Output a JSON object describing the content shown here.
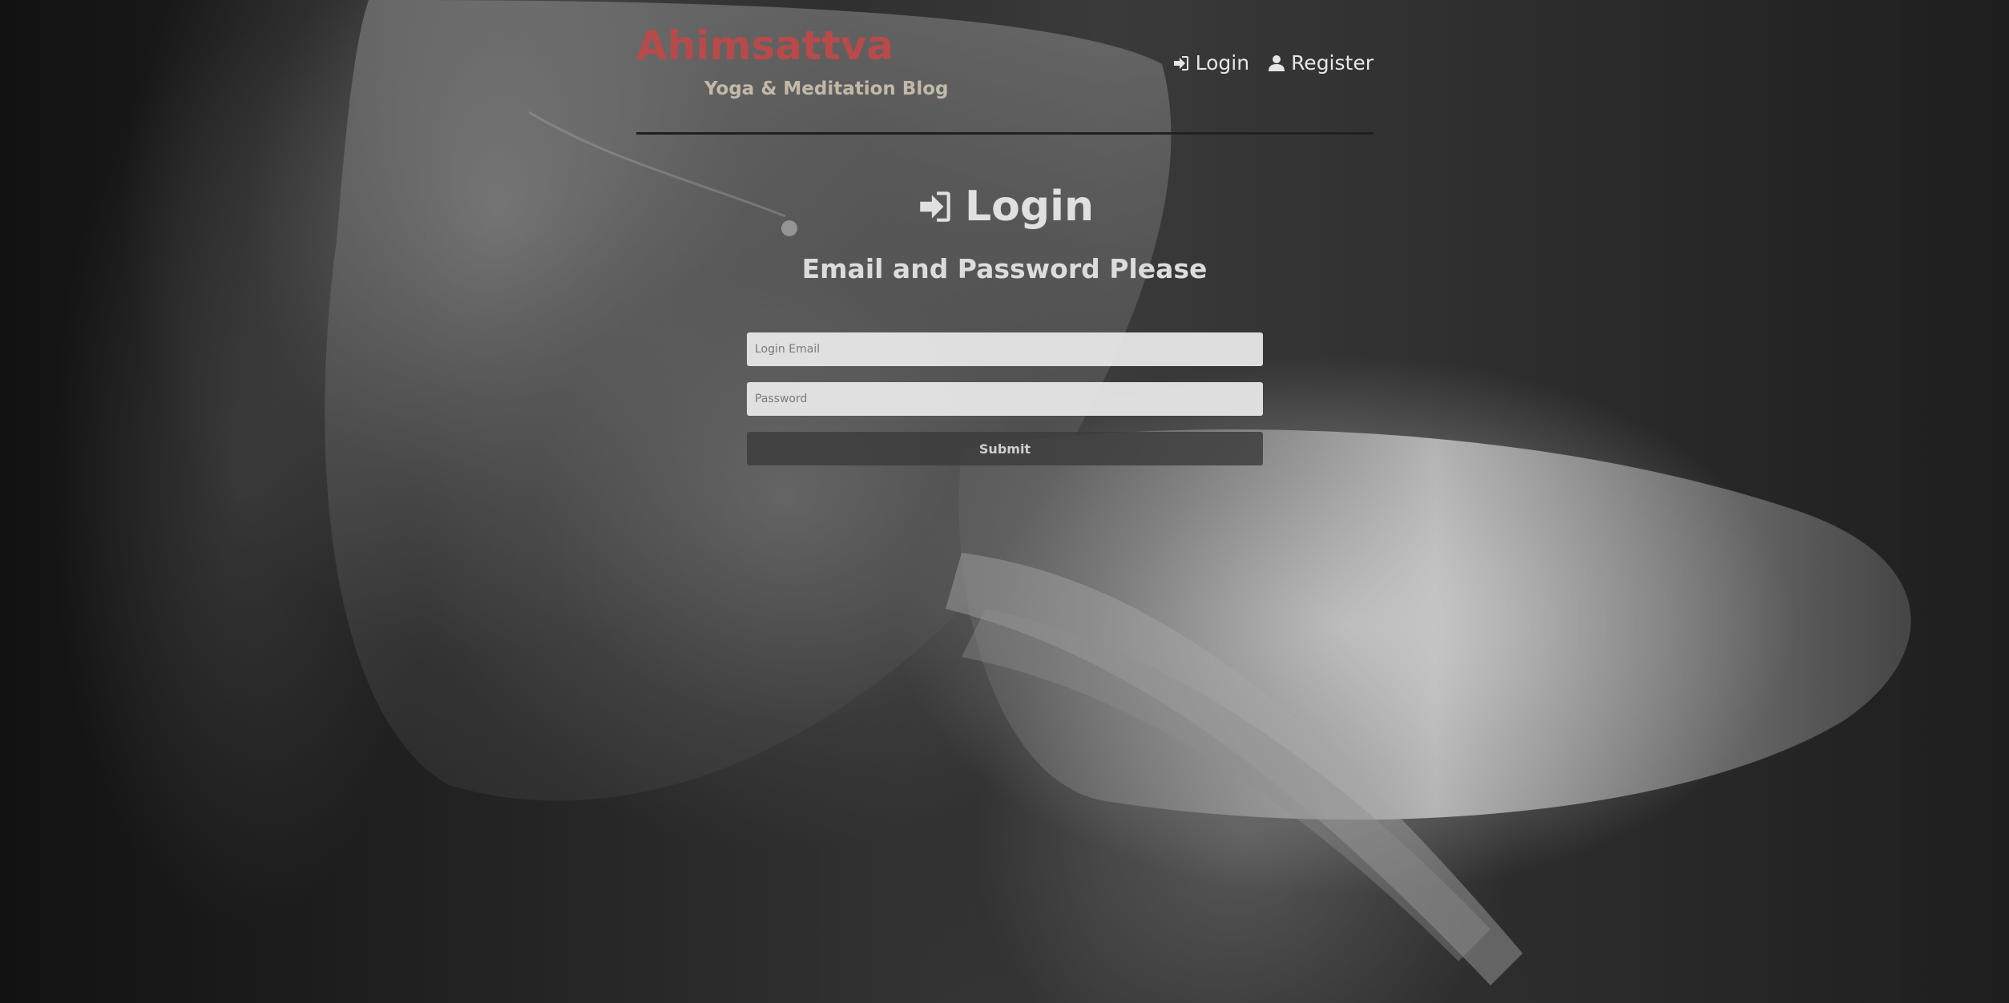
{
  "header": {
    "brand_title": "Ahimsattva",
    "brand_subtitle": "Yoga & Meditation Blog",
    "nav": {
      "login_label": "Login",
      "register_label": "Register"
    }
  },
  "main": {
    "heading": "Login",
    "subheading": "Email and Password Please",
    "form": {
      "email_placeholder": "Login Email",
      "password_placeholder": "Password",
      "submit_label": "Submit"
    }
  },
  "icons": {
    "login": "sign-in-icon",
    "register": "user-icon"
  },
  "colors": {
    "brand_title": "#b84a4a",
    "brand_subtitle": "#c2b9a8",
    "submit_bg": "#3c3c3c"
  }
}
